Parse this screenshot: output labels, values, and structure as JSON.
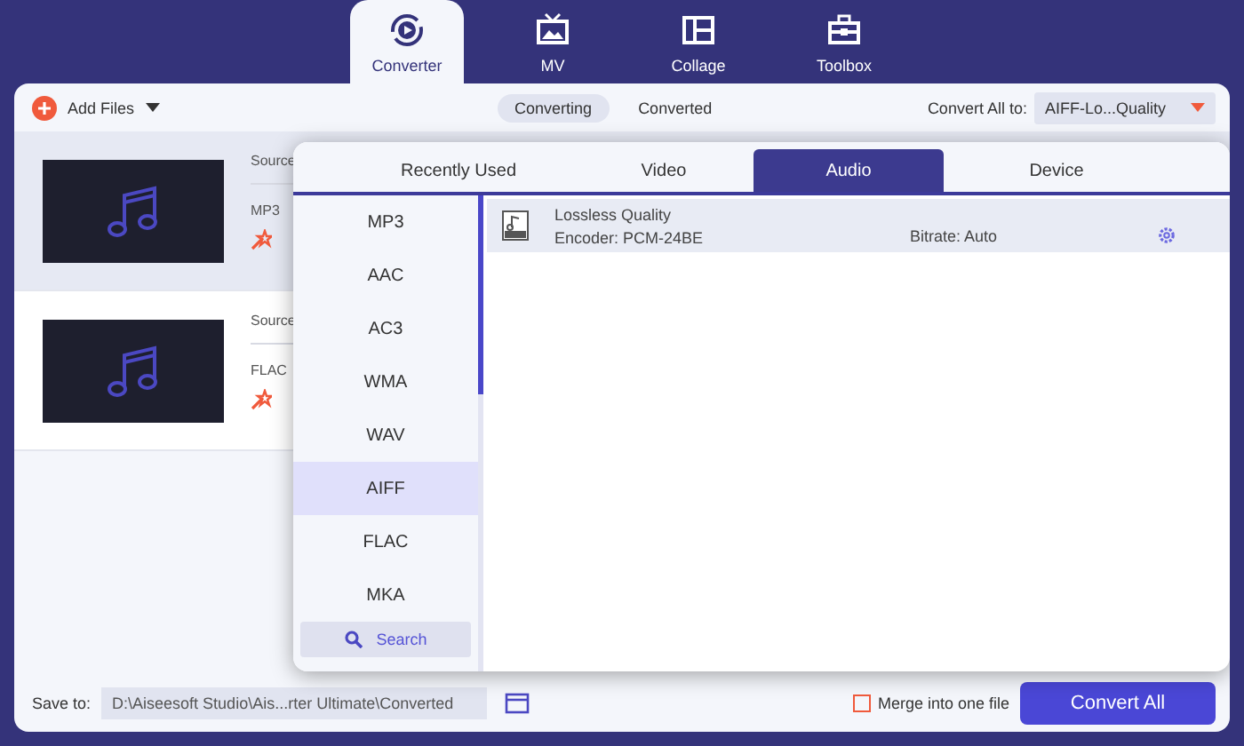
{
  "nav_tabs": [
    {
      "label": "Converter",
      "selected": true
    },
    {
      "label": "MV",
      "selected": false
    },
    {
      "label": "Collage",
      "selected": false
    },
    {
      "label": "Toolbox",
      "selected": false
    }
  ],
  "toolbar": {
    "add_files": "Add Files",
    "view_tabs": [
      {
        "label": "Converting",
        "selected": true
      },
      {
        "label": "Converted",
        "selected": false
      }
    ],
    "convert_all_label": "Convert All to:",
    "convert_all_value": "AIFF-Lo...Quality"
  },
  "files": [
    {
      "source": "Source",
      "format": "MP3",
      "selected": true
    },
    {
      "source": "Source",
      "format": "FLAC",
      "selected": false
    }
  ],
  "format_popup": {
    "tabs": [
      {
        "label": "Recently Used",
        "selected": false
      },
      {
        "label": "Video",
        "selected": false
      },
      {
        "label": "Audio",
        "selected": true
      },
      {
        "label": "Device",
        "selected": false
      }
    ],
    "formats": [
      {
        "label": "MP3",
        "selected": false
      },
      {
        "label": "AAC",
        "selected": false
      },
      {
        "label": "AC3",
        "selected": false
      },
      {
        "label": "WMA",
        "selected": false
      },
      {
        "label": "WAV",
        "selected": false
      },
      {
        "label": "AIFF",
        "selected": true
      },
      {
        "label": "FLAC",
        "selected": false
      },
      {
        "label": "MKA",
        "selected": false
      }
    ],
    "search": "Search",
    "presets": [
      {
        "name": "Lossless Quality",
        "encoder": "Encoder: PCM-24BE",
        "bitrate": "Bitrate: Auto",
        "selected": true
      }
    ]
  },
  "bottom_bar": {
    "save_to_label": "Save to:",
    "path": "D:\\Aiseesoft Studio\\Ais...rter Ultimate\\Converted",
    "merge_label": "Merge into one file",
    "merge_checked": false,
    "convert_button": "Convert All"
  }
}
